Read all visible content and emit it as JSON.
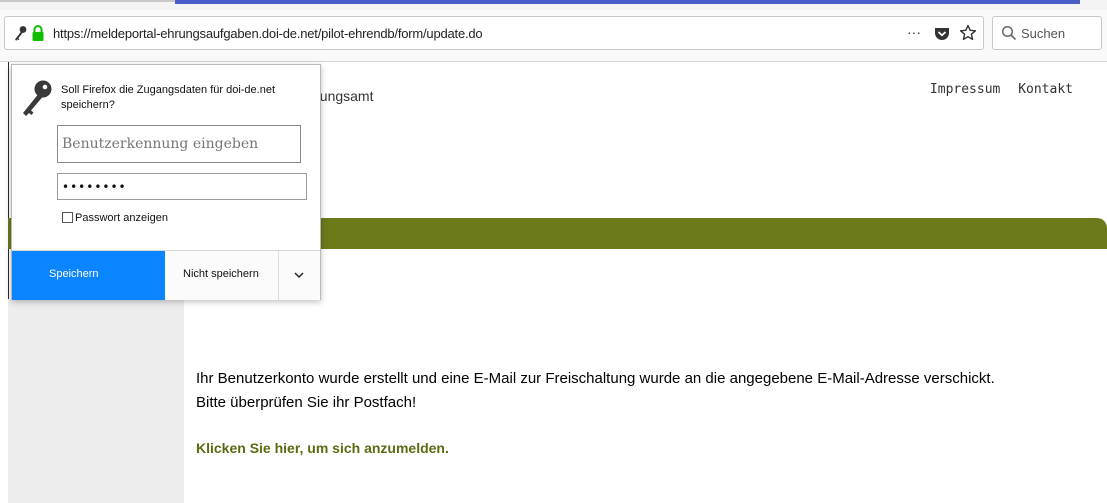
{
  "browser": {
    "url": "https://meldeportal-ehrungsaufgaben.doi-de.net/pilot-ehrendb/form/update.do",
    "more_label": "···",
    "search_placeholder": "Suchen"
  },
  "page": {
    "agency_name_visible": "valtungsamt",
    "top_links": [
      "Impressum",
      "Kontakt"
    ],
    "message_line1": "Ihr Benutzerkonto wurde erstellt und eine E-Mail zur Freischaltung wurde an die angegebene E-Mail-Adresse verschickt.",
    "message_line2": "Bitte überprüfen Sie ihr Postfach!",
    "login_link": "Klicken Sie hier, um sich anzumelden.",
    "accent_color": "#6c7a1a"
  },
  "password_popup": {
    "question": "Soll Firefox die Zugangsdaten für doi-de.net speichern?",
    "username_placeholder": "Benutzerkennung eingeben",
    "password_value": "••••••••",
    "show_password_label": "Passwort anzeigen",
    "save_button": "Speichern",
    "dont_save_button": "Nicht speichern",
    "save_color": "#0a84ff"
  }
}
